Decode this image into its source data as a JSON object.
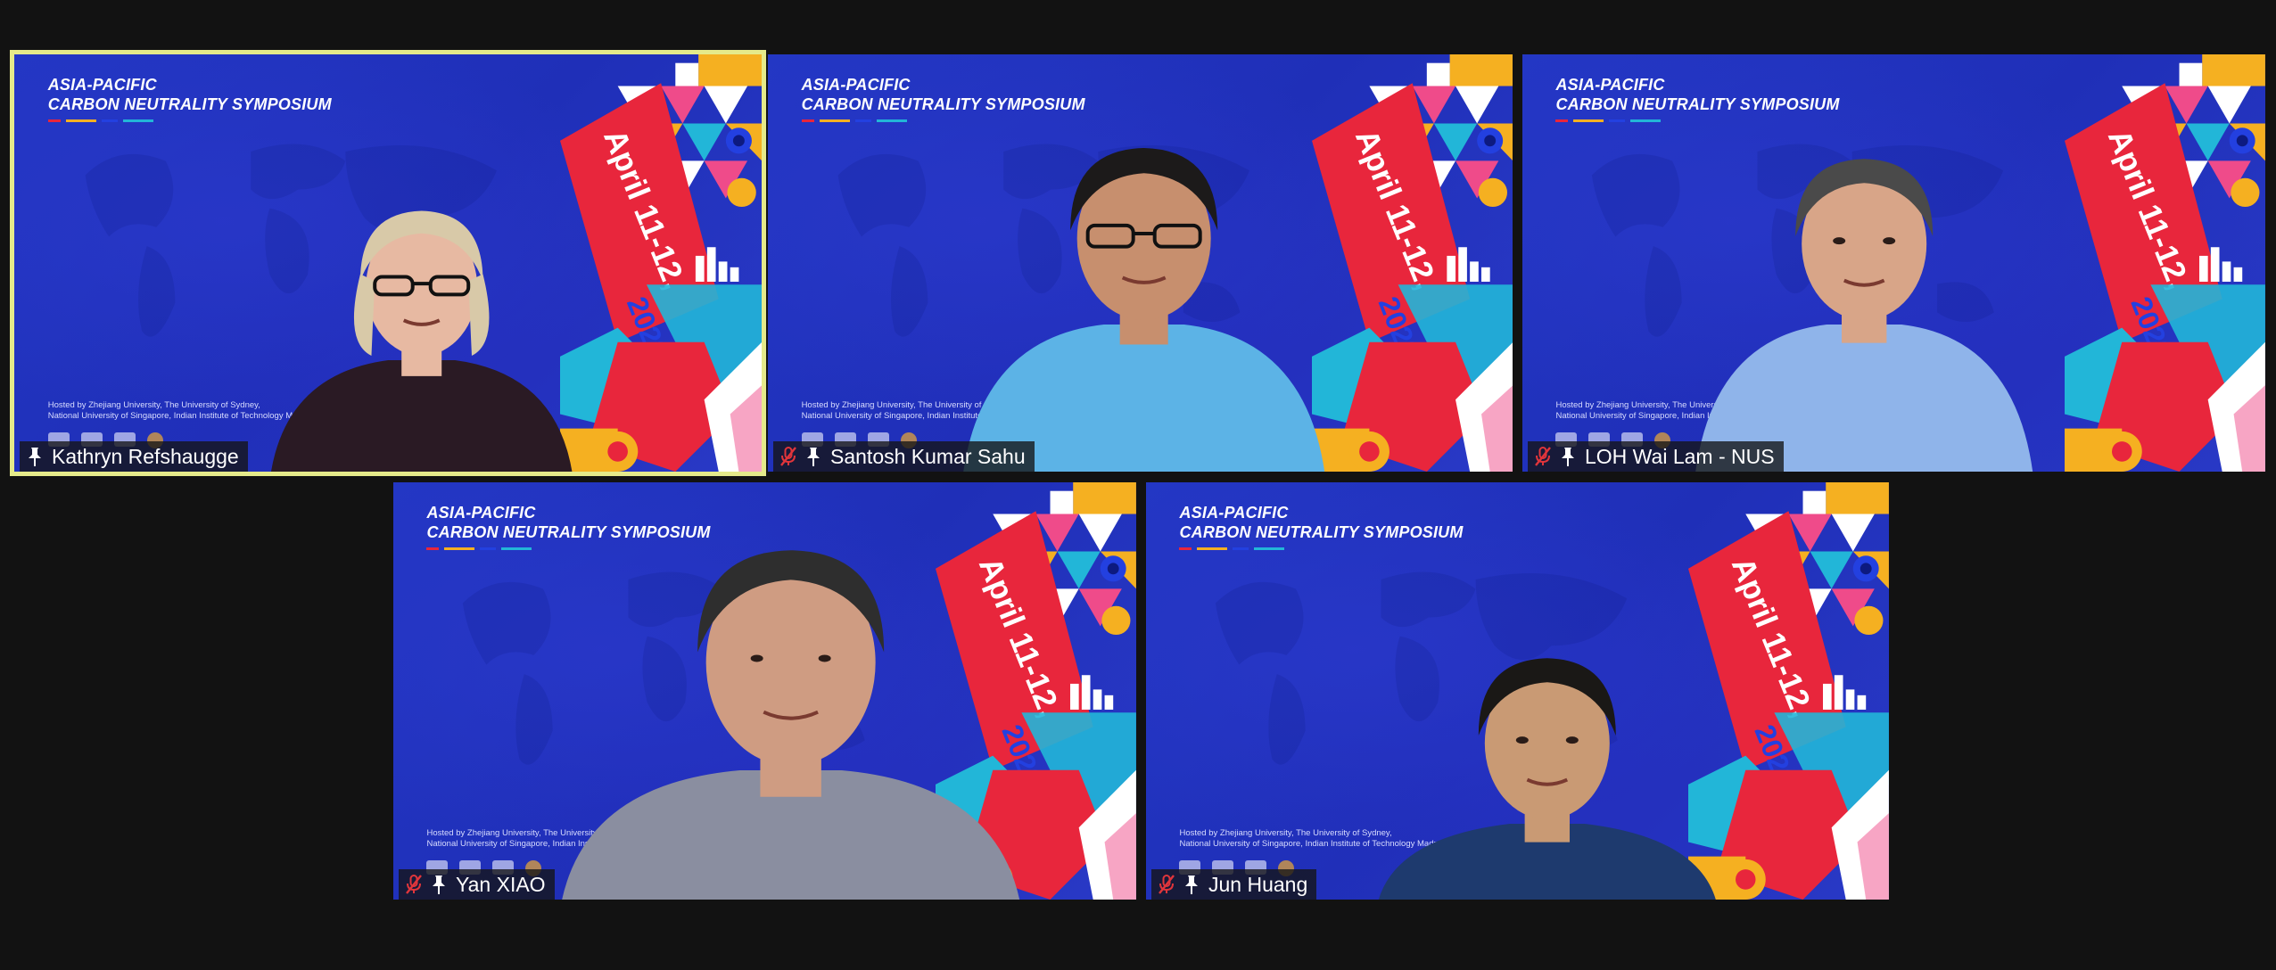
{
  "banner": {
    "line1": "ASIA-PACIFIC",
    "line2": "CARBON NEUTRALITY SYMPOSIUM",
    "date": "April 11-12,",
    "year": "2022",
    "hosted_line1": "Hosted by Zhejiang University, The University of Sydney,",
    "hosted_line2": "National University of Singapore, Indian Institute of Technology Madras"
  },
  "participants": [
    {
      "name": "Kathryn Refshaugge",
      "muted": false,
      "active_speaker": true
    },
    {
      "name": "Santosh Kumar Sahu",
      "muted": true,
      "active_speaker": false
    },
    {
      "name": "LOH Wai Lam - NUS",
      "muted": true,
      "active_speaker": false
    },
    {
      "name": "Yan XIAO",
      "muted": true,
      "active_speaker": false
    },
    {
      "name": "Jun Huang",
      "muted": true,
      "active_speaker": false
    }
  ],
  "colors": {
    "background": "#121212",
    "slide_blue": "#2337c4",
    "active_border": "#e5ea8a",
    "muted_red": "#e0353b",
    "art_red": "#e8263c",
    "art_yellow": "#f5b021",
    "art_cyan": "#22b6d8",
    "art_pink": "#ef4b8a"
  }
}
